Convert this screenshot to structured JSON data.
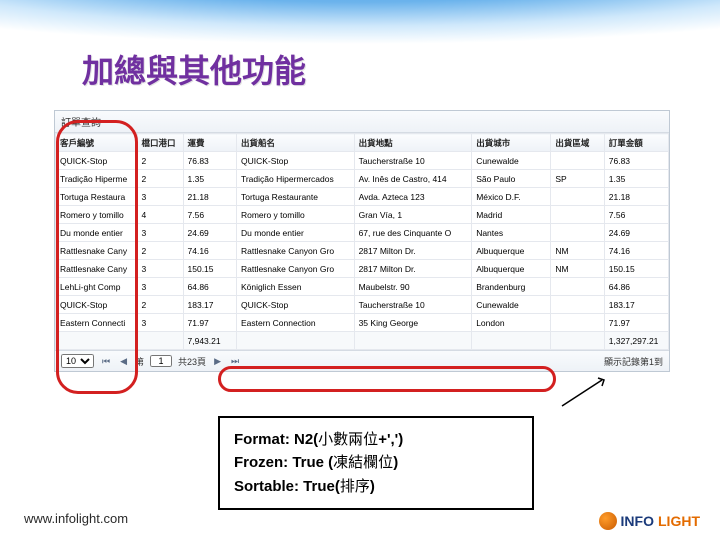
{
  "slide_title": "加總與其他功能",
  "panel_title": "訂單查詢",
  "headers": {
    "customer": "客戶編號",
    "port": "檔口港口",
    "freight": "運費",
    "shipname": "出貨船名",
    "shipaddr": "出貨地點",
    "shipcity": "出貨城市",
    "shipregion": "出貨區域",
    "amount": "訂單金額"
  },
  "rows": [
    {
      "customer": "QUICK-Stop",
      "port": "2",
      "freight": "76.83",
      "shipname": "QUICK-Stop",
      "shipaddr": "Taucherstraße 10",
      "shipcity": "Cunewalde",
      "shipregion": "",
      "amount": "76.83"
    },
    {
      "customer": "Tradição Hiperme",
      "port": "2",
      "freight": "1.35",
      "shipname": "Tradição Hipermercados",
      "shipaddr": "Av. Inês de Castro, 414",
      "shipcity": "São Paulo",
      "shipregion": "SP",
      "amount": "1.35"
    },
    {
      "customer": "Tortuga Restaura",
      "port": "3",
      "freight": "21.18",
      "shipname": "Tortuga Restaurante",
      "shipaddr": "Avda. Azteca 123",
      "shipcity": "México D.F.",
      "shipregion": "",
      "amount": "21.18"
    },
    {
      "customer": "Romero y tomillo",
      "port": "4",
      "freight": "7.56",
      "shipname": "Romero y tomillo",
      "shipaddr": "Gran Vía, 1",
      "shipcity": "Madrid",
      "shipregion": "",
      "amount": "7.56"
    },
    {
      "customer": "Du monde entier",
      "port": "3",
      "freight": "24.69",
      "shipname": "Du monde entier",
      "shipaddr": "67, rue des Cinquante O",
      "shipcity": "Nantes",
      "shipregion": "",
      "amount": "24.69"
    },
    {
      "customer": "Rattlesnake Cany",
      "port": "2",
      "freight": "74.16",
      "shipname": "Rattlesnake Canyon Gro",
      "shipaddr": "2817 Milton Dr.",
      "shipcity": "Albuquerque",
      "shipregion": "NM",
      "amount": "74.16"
    },
    {
      "customer": "Rattlesnake Cany",
      "port": "3",
      "freight": "150.15",
      "shipname": "Rattlesnake Canyon Gro",
      "shipaddr": "2817 Milton Dr.",
      "shipcity": "Albuquerque",
      "shipregion": "NM",
      "amount": "150.15"
    },
    {
      "customer": "LehLi-ght Comp",
      "port": "3",
      "freight": "64.86",
      "shipname": "Königlich Essen",
      "shipaddr": "Maubelstr. 90",
      "shipcity": "Brandenburg",
      "shipregion": "",
      "amount": "64.86"
    },
    {
      "customer": "QUICK-Stop",
      "port": "2",
      "freight": "183.17",
      "shipname": "QUICK-Stop",
      "shipaddr": "Taucherstraße 10",
      "shipcity": "Cunewalde",
      "shipregion": "",
      "amount": "183.17"
    },
    {
      "customer": "Eastern Connecti",
      "port": "3",
      "freight": "71.97",
      "shipname": "Eastern Connection",
      "shipaddr": "35 King George",
      "shipcity": "London",
      "shipregion": "",
      "amount": "71.97"
    }
  ],
  "sumrow": {
    "freight": "7,943.21",
    "amount": "1,327,297.21"
  },
  "pager": {
    "pagesize": "10",
    "page_label": "第",
    "page_value": "1",
    "total_label": "共23頁",
    "info_right": "顯示記錄第1到"
  },
  "callout": {
    "line1_a": "Format: N2(",
    "line1_b": "小數兩位",
    "line1_c": "+',')",
    "line2_a": "Frozen: True (",
    "line2_b": "凍結欄位",
    "line2_c": ")",
    "line3_a": "Sortable: True(",
    "line3_b": "排序",
    "line3_c": ")"
  },
  "footer_url": "www.infolight.com",
  "logo_main": "INFO",
  "logo_sub": "LIGHT"
}
